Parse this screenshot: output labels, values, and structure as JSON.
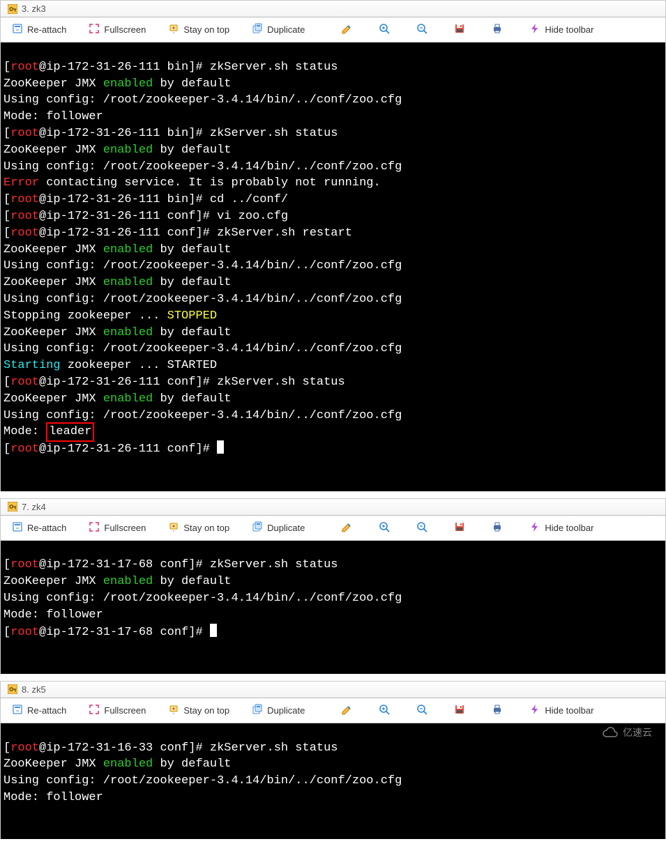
{
  "toolbar": {
    "reattach": "Re-attach",
    "fullscreen": "Fullscreen",
    "stayontop": "Stay on top",
    "duplicate": "Duplicate",
    "hidetoolbar": "Hide toolbar"
  },
  "windows": [
    {
      "tab": "3. zk3",
      "host_ip": "ip-172-31-26-111",
      "prompt_user": "root",
      "lines": [
        {
          "t": "prompt",
          "dir": "bin",
          "cmd": "zkServer.sh status"
        },
        {
          "t": "jmx"
        },
        {
          "t": "config"
        },
        {
          "t": "plain",
          "text": "Mode: follower"
        },
        {
          "t": "prompt",
          "dir": "bin",
          "cmd": "zkServer.sh status"
        },
        {
          "t": "jmx"
        },
        {
          "t": "config"
        },
        {
          "t": "error",
          "text": " contacting service. It is probably not running.",
          "err": "Error"
        },
        {
          "t": "prompt",
          "dir": "bin",
          "cmd": "cd ../conf/"
        },
        {
          "t": "prompt",
          "dir": "conf",
          "cmd": "vi zoo.cfg"
        },
        {
          "t": "prompt",
          "dir": "conf",
          "cmd": "zkServer.sh restart"
        },
        {
          "t": "jmx"
        },
        {
          "t": "config"
        },
        {
          "t": "jmx"
        },
        {
          "t": "config"
        },
        {
          "t": "stop"
        },
        {
          "t": "jmx"
        },
        {
          "t": "config"
        },
        {
          "t": "start"
        },
        {
          "t": "prompt",
          "dir": "conf",
          "cmd": "zkServer.sh status"
        },
        {
          "t": "jmx"
        },
        {
          "t": "config"
        },
        {
          "t": "mode-leader",
          "prefix": "Mode: ",
          "val": "leader"
        },
        {
          "t": "prompt",
          "dir": "conf",
          "cmd": "",
          "cursor": true
        }
      ]
    },
    {
      "tab": "7. zk4",
      "host_ip": "ip-172-31-17-68",
      "prompt_user": "root",
      "lines": [
        {
          "t": "prompt",
          "dir": "conf",
          "cmd": "zkServer.sh status"
        },
        {
          "t": "jmx"
        },
        {
          "t": "config"
        },
        {
          "t": "plain",
          "text": "Mode: follower"
        },
        {
          "t": "prompt",
          "dir": "conf",
          "cmd": "",
          "cursor": true
        }
      ]
    },
    {
      "tab": "8. zk5",
      "host_ip": "ip-172-31-16-33",
      "prompt_user": "root",
      "lines": [
        {
          "t": "prompt",
          "dir": "conf",
          "cmd": "zkServer.sh status"
        },
        {
          "t": "jmx"
        },
        {
          "t": "config"
        },
        {
          "t": "plain",
          "text": "Mode: follower"
        }
      ]
    }
  ],
  "strings": {
    "jmx_pre": "ZooKeeper JMX ",
    "jmx_enabled": "enabled",
    "jmx_post": " by default",
    "config": "Using config: /root/zookeeper-3.4.14/bin/../conf/zoo.cfg",
    "stop_pre": "Stopping zookeeper ... ",
    "stop_val": "STOPPED",
    "start_pre": "Starting",
    "start_mid": " zookeeper ... STARTED"
  },
  "watermark": "亿速云"
}
